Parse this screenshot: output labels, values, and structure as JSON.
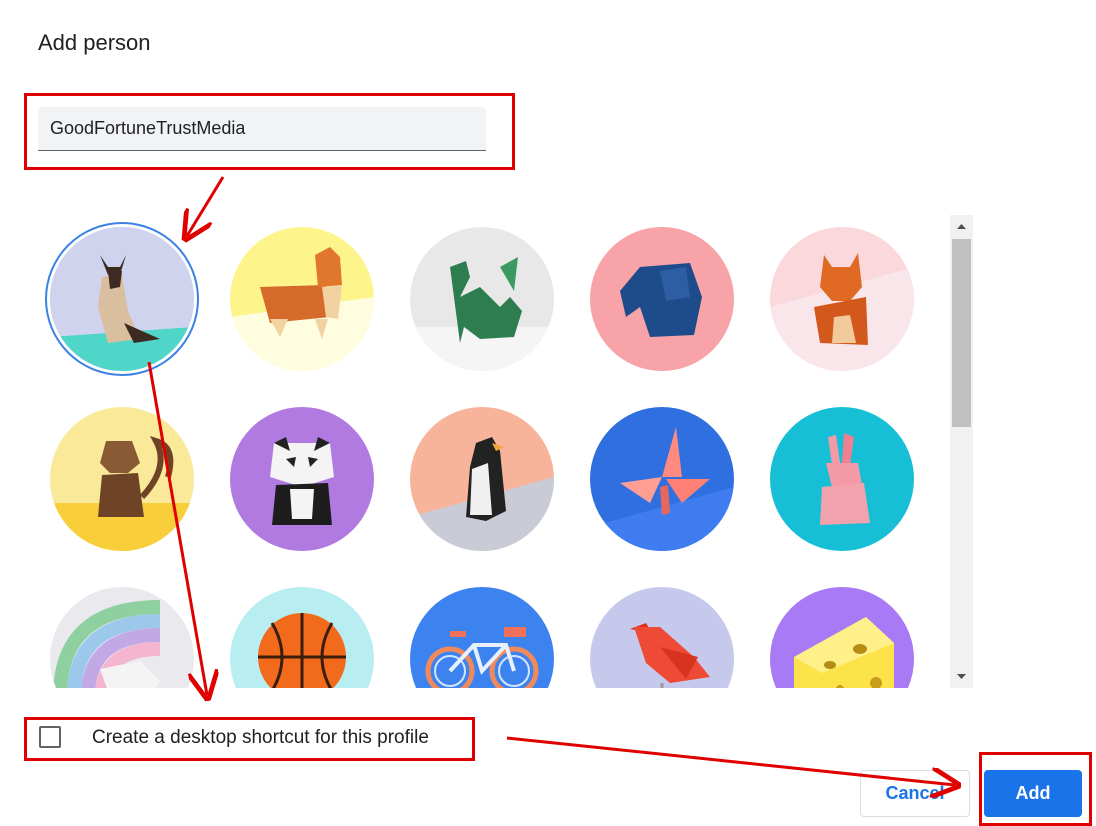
{
  "dialog": {
    "title": "Add person",
    "name_input_value": "GoodFortuneTrustMedia",
    "checkbox_label": "Create a desktop shortcut for this profile",
    "checkbox_checked": false,
    "cancel_label": "Cancel",
    "add_label": "Add"
  },
  "avatars": [
    {
      "name": "cat",
      "selected": true
    },
    {
      "name": "corgi",
      "selected": false
    },
    {
      "name": "dragon",
      "selected": false
    },
    {
      "name": "elephant",
      "selected": false
    },
    {
      "name": "fox",
      "selected": false
    },
    {
      "name": "monkey",
      "selected": false
    },
    {
      "name": "panda",
      "selected": false
    },
    {
      "name": "penguin",
      "selected": false
    },
    {
      "name": "butterfly",
      "selected": false
    },
    {
      "name": "rabbit",
      "selected": false
    },
    {
      "name": "unicorn",
      "selected": false
    },
    {
      "name": "basketball",
      "selected": false
    },
    {
      "name": "bicycle",
      "selected": false
    },
    {
      "name": "bird",
      "selected": false
    },
    {
      "name": "cheese",
      "selected": false
    }
  ],
  "colors": {
    "accent": "#1a73e8",
    "annotation": "#e00000",
    "selection_ring": "#3b82e6"
  }
}
